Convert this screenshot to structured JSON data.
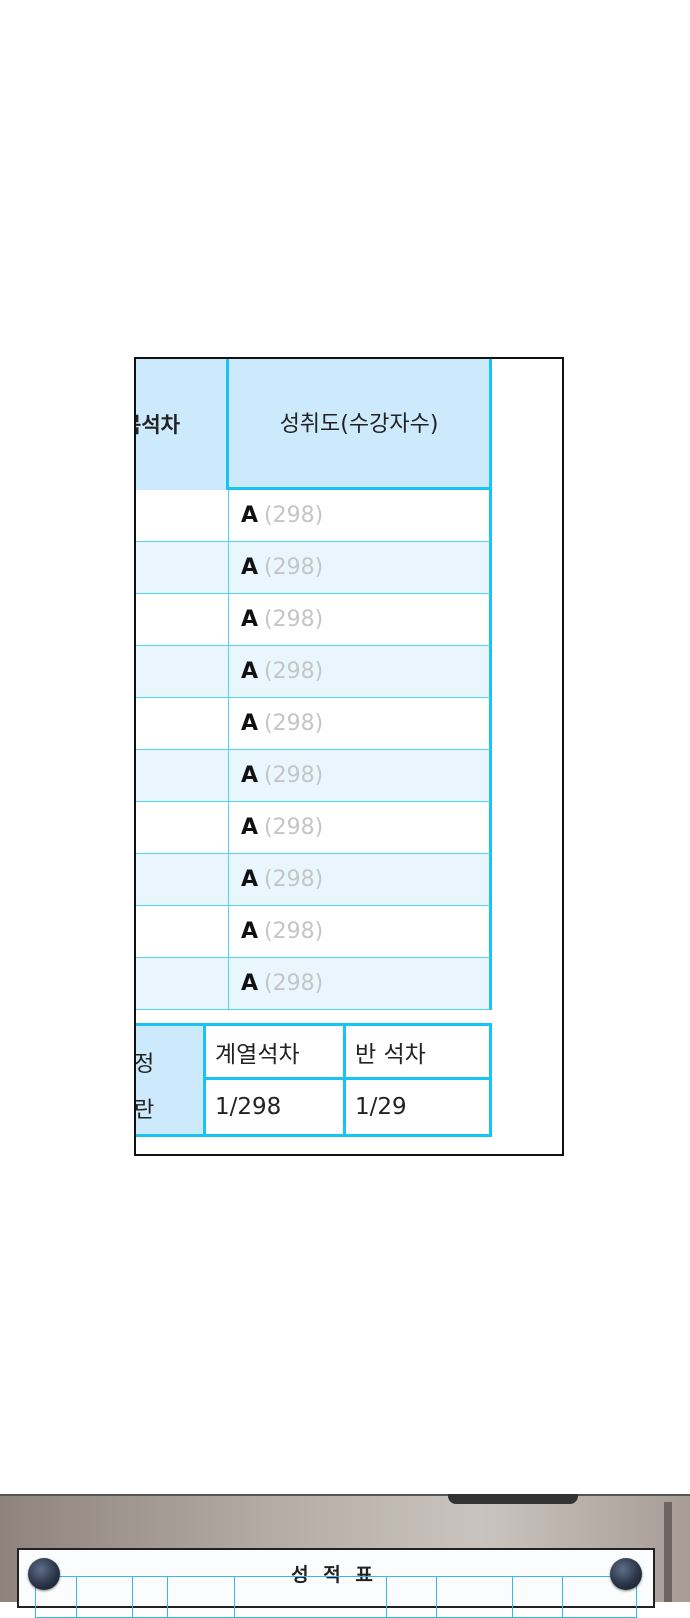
{
  "grade_table": {
    "left_header": "목석차",
    "right_header": "성취도(수강자수)",
    "rows": [
      {
        "grade": "A",
        "count": "(298)"
      },
      {
        "grade": "A",
        "count": "(298)"
      },
      {
        "grade": "A",
        "count": "(298)"
      },
      {
        "grade": "A",
        "count": "(298)"
      },
      {
        "grade": "A",
        "count": "(298)"
      },
      {
        "grade": "A",
        "count": "(298)"
      },
      {
        "grade": "A",
        "count": "(298)"
      },
      {
        "grade": "A",
        "count": "(298)"
      },
      {
        "grade": "A",
        "count": "(298)"
      },
      {
        "grade": "A",
        "count": "(298)"
      }
    ]
  },
  "rank_section": {
    "label_line1": "정",
    "label_line2": "란",
    "headers": [
      "계열석차",
      "반 석차"
    ],
    "values": [
      "1/298",
      "1/29"
    ]
  },
  "bottom_sheet": {
    "title": "성 적 표"
  }
}
